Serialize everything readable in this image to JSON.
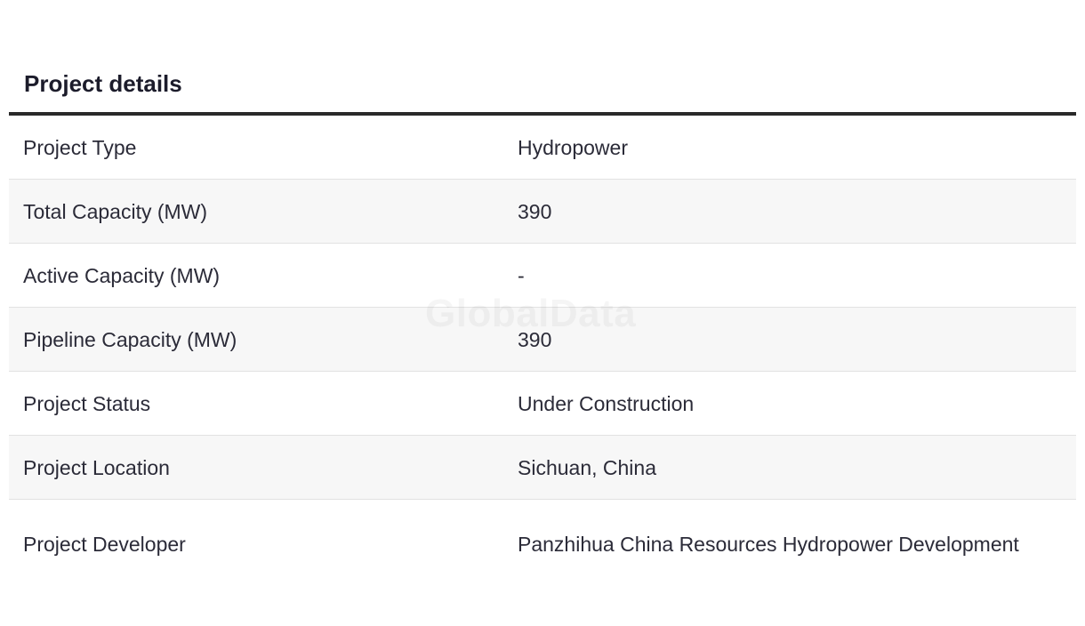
{
  "title": "Project details",
  "rows": [
    {
      "label": "Project Type",
      "value": "Hydropower"
    },
    {
      "label": "Total Capacity (MW)",
      "value": "390"
    },
    {
      "label": "Active Capacity (MW)",
      "value": "-"
    },
    {
      "label": "Pipeline Capacity (MW)",
      "value": "390"
    },
    {
      "label": "Project Status",
      "value": "Under Construction"
    },
    {
      "label": "Project Location",
      "value": "Sichuan, China"
    },
    {
      "label": "Project Developer",
      "value": "Panzhihua China Resources Hydropower Development"
    }
  ],
  "watermark": "GlobalData"
}
